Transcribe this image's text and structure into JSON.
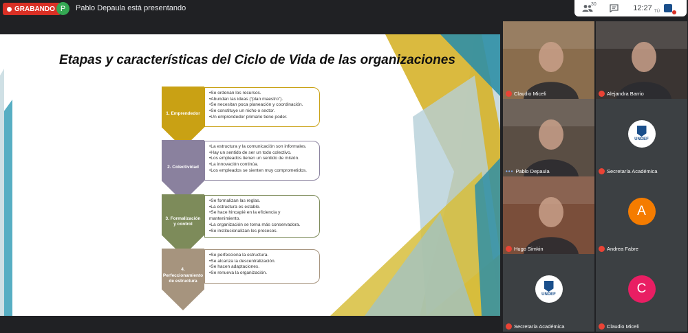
{
  "topbar": {
    "recording_label": "GRABANDO",
    "presenter_initial": "P",
    "presenter_text": "Pablo Depaula está presentando",
    "participants_count": "30",
    "time": "12:27",
    "self_label": "TÚ"
  },
  "slide": {
    "title": "Etapas y características del Ciclo de Vida de las organizaciones",
    "stages": [
      {
        "label": "1. Emprendedor",
        "color": "#c9a114",
        "items": [
          "•Se ordenan los recursos.",
          "•Abundan las ideas (“plan maestro”).",
          "•Se necesitan poca planeación y coordinación.",
          "•Se constituye un nicho o sector.",
          "•Un emprendedor primario tiene poder."
        ]
      },
      {
        "label": "2. Colectividad",
        "color": "#8a819e",
        "items": [
          "•La estructura y la comunicación son informales.",
          "•Hay un sentido de ser un todo colectivo.",
          "•Los empleados tienen un sentido de misión.",
          "•La innovación continúa.",
          "•Los empleados se sienten muy comprometidos."
        ]
      },
      {
        "label": "3. Formalización y control",
        "color": "#7d8b5a",
        "items": [
          "•Se formalizan las reglas.",
          "•La estructura es estable.",
          "•Se hace hincapié en la eficiencia y",
          "  mantenimiento.",
          "•La organización se torna más conservadora.",
          "•Se institucionalizan los procesos."
        ]
      },
      {
        "label": "4. Perfeccionamiento de estructura",
        "color": "#a6947e",
        "items": [
          "•Se perfecciona la estructura.",
          "•Se alcanza la descentralización.",
          "•Se hacen adaptaciones.",
          "•Se renueva la organización."
        ]
      }
    ]
  },
  "participants": [
    {
      "name": "Claudio Miceli",
      "type": "video",
      "bg": "#8a6d4d"
    },
    {
      "name": "Alejandra Barrio",
      "type": "video",
      "bg": "#3a3432"
    },
    {
      "name": "Pablo Depaula",
      "type": "video",
      "bg": "#5a4e44"
    },
    {
      "name": "Secretaría Académica",
      "type": "logo",
      "logo_text": "UNDEF"
    },
    {
      "name": "Hugo Simkin",
      "type": "video",
      "bg": "#7a4e3a"
    },
    {
      "name": "Andrea Fabre",
      "type": "avatar",
      "initial": "A",
      "color": "#f57c00"
    },
    {
      "name": "Secretaría Académica",
      "type": "logo",
      "logo_text": "UNDEF"
    },
    {
      "name": "Claudio Miceli",
      "type": "avatar",
      "initial": "C",
      "color": "#e91e63"
    }
  ],
  "colors": {
    "accent_red": "#d93025",
    "dark_bg": "#202124"
  }
}
